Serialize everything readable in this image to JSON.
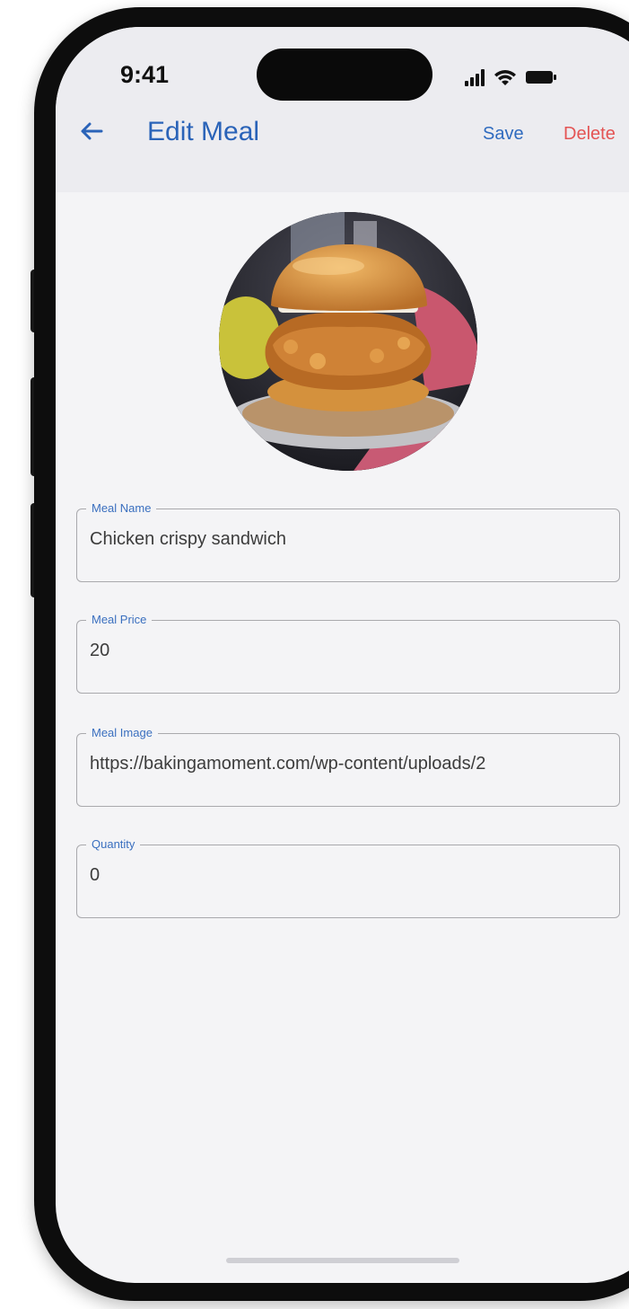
{
  "status_bar": {
    "time": "9:41",
    "signal_icon": "cellular-signal-icon",
    "wifi_icon": "wifi-icon",
    "battery_icon": "battery-icon"
  },
  "app_bar": {
    "back_icon": "arrow-left-icon",
    "title": "Edit Meal",
    "save_label": "Save",
    "delete_label": "Delete"
  },
  "meal_photo": {
    "subject": "chicken-sandwich-photo"
  },
  "form": {
    "meal_name": {
      "label": "Meal Name",
      "value": "Chicken crispy sandwich"
    },
    "meal_price": {
      "label": "Meal Price",
      "value": "20"
    },
    "meal_image": {
      "label": "Meal Image",
      "value": "https://bakingamoment.com/wp-content/uploads/2"
    },
    "quantity": {
      "label": "Quantity",
      "value": "0"
    }
  },
  "colors": {
    "accent": "#2a63b8",
    "delete": "#e45454",
    "screen_bg": "#f4f4f6",
    "header_bg": "#ececf0"
  }
}
